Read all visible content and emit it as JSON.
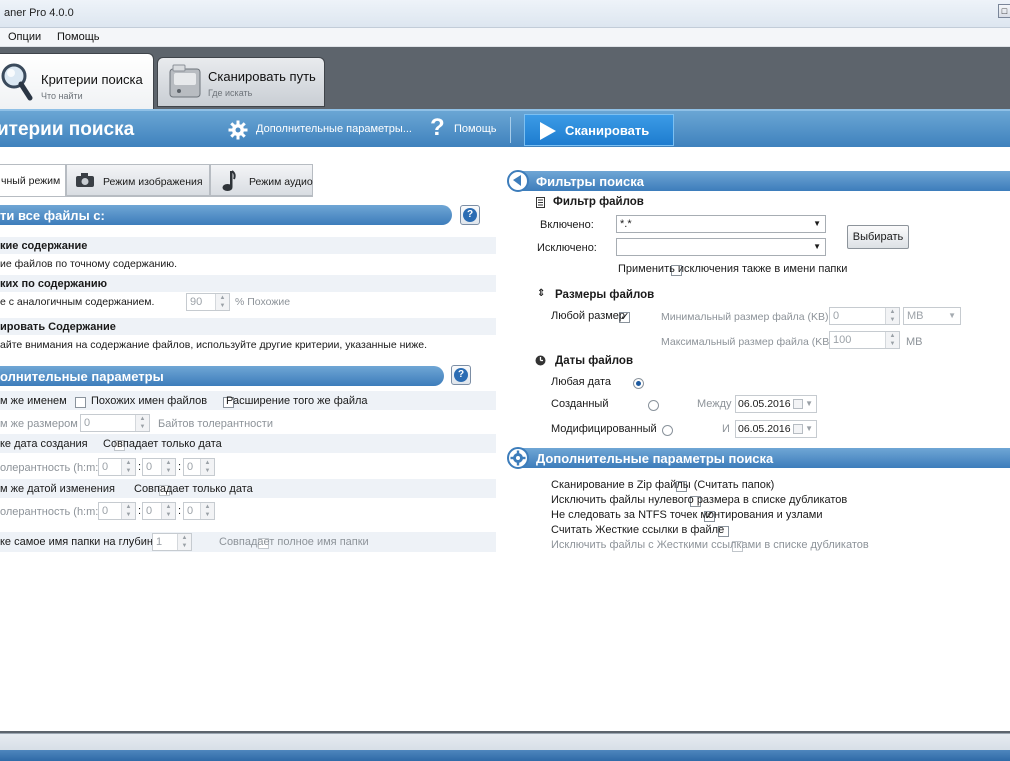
{
  "window": {
    "title": "aner Pro 4.0.0",
    "close_glyph": "□"
  },
  "menu": {
    "items": [
      "Опции",
      "Помощь"
    ]
  },
  "main_tabs": [
    {
      "title": "Критерии поиска",
      "subtitle": "Что найти"
    },
    {
      "title": "Сканировать путь",
      "subtitle": "Где искать"
    }
  ],
  "header": {
    "title": "итерии поиска",
    "advanced_params": "Дополнительные параметры...",
    "help": "Помощь",
    "scan_button": "Сканировать"
  },
  "sub_tabs": [
    "чный режим",
    "Режим изображения",
    "Режим аудио"
  ],
  "find_section": {
    "title": "ти все файлы с:",
    "options": [
      {
        "title": "кие содержание",
        "desc": "ие файлов по точному содержанию."
      },
      {
        "title": "ких по содержанию",
        "desc": "е с аналогичным содержанием.",
        "value": "90",
        "unit": "% Похожие"
      },
      {
        "title": "ировать Содержание",
        "desc": "айте внимания на содержание файлов, используйте другие критерии, указанные ниже."
      }
    ]
  },
  "extra_section": {
    "title": "олнительные параметры",
    "same_name": "м же именем",
    "similar_names": "Похожих имен файлов",
    "same_extension": "Расширение того же файла",
    "same_size": "м же размером",
    "size_value": "0",
    "size_tolerance": "Байтов толерантности",
    "creation_date": "ке дата создания",
    "date_only_1": "Совпадает только дата",
    "tolerance_label": "олерантность (h:m:s)",
    "time_values": [
      "0",
      "0",
      "0"
    ],
    "mod_date": "м же датой изменения",
    "date_only_2": "Совпадает только дата",
    "folder_depth": "ке самое имя папки на глубину",
    "depth_value": "1",
    "full_folder_name": "Совпадает полное имя папки"
  },
  "filters": {
    "title": "Фильтры поиска",
    "file_filter": {
      "title": "Фильтр файлов",
      "include_label": "Включено:",
      "include_value": "*.*",
      "exclude_label": "Исключено:",
      "exclude_value": "",
      "select_button": "Выбирать",
      "apply_folder_label": "Применить исключения также в имени папки"
    },
    "sizes": {
      "title": "Размеры файлов",
      "any_size": "Любой размер",
      "min_label": "Минимальный размер файла (KB)",
      "min_value": "0",
      "unit": "MB",
      "max_label": "Максимальный размер файла (KB)",
      "max_value": "100",
      "max_unit": "MB"
    },
    "dates": {
      "title": "Даты файлов",
      "any_date": "Любая дата",
      "created": "Созданный",
      "modified": "Модифицированный",
      "between": "Между",
      "and": "И",
      "date1": "06.05.2016",
      "date2": "06.05.2016"
    }
  },
  "advanced": {
    "title": "Дополнительные параметры поиска",
    "items": [
      {
        "label": "Сканирование в Zip файлы (Считать папок)",
        "checked": false
      },
      {
        "label": "Исключить файлы нулевого размера в списке дубликатов",
        "checked": false
      },
      {
        "label": "Не следовать за NTFS точек монтирования и узлами",
        "checked": true
      },
      {
        "label": "Считать Жесткие ссылки в файле",
        "checked": false
      },
      {
        "label": "Исключить файлы с Жесткими ссылками в списке дубликатов",
        "checked": false
      }
    ]
  },
  "colors": {
    "accent": "#3d7dbb",
    "scan_button": "#1e7ccf",
    "tab_strip": "#5d646c"
  }
}
